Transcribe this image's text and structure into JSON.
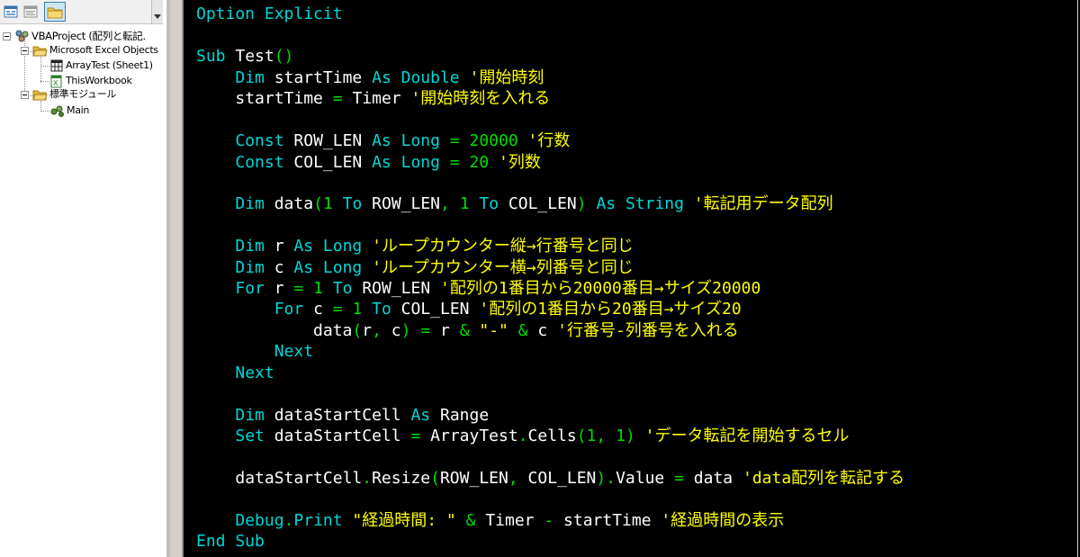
{
  "explorer": {
    "project_label": "VBAProject (配列と転記.",
    "folder_objects_label": "Microsoft Excel Objects",
    "sheet_label": "ArrayTest (Sheet1)",
    "workbook_label": "ThisWorkbook",
    "folder_modules_label": "標準モジュール",
    "module_label": "Main"
  },
  "colors": {
    "keyword": "#00d7d7",
    "identifier": "#ffffff",
    "number_operator": "#00dd00",
    "comment_string": "#ffff00",
    "background": "#000000"
  },
  "code": {
    "l1": {
      "a": "Option Explicit"
    },
    "l3": {
      "a": "Sub",
      "b": "Test",
      "c": "()"
    },
    "l4": {
      "a": "Dim",
      "b": "startTime",
      "c": "As Double",
      "d": "'開始時刻"
    },
    "l5": {
      "a": "startTime",
      "b": "=",
      "c": "Timer",
      "d": "'開始時刻を入れる"
    },
    "l7": {
      "a": "Const",
      "b": "ROW_LEN",
      "c": "As Long",
      "d": "=",
      "e": "20000",
      "f": "'行数"
    },
    "l8": {
      "a": "Const",
      "b": "COL_LEN",
      "c": "As Long",
      "d": "=",
      "e": "20",
      "f": "'列数"
    },
    "l10": {
      "a": "Dim",
      "b": "data",
      "c": "(",
      "d": "1",
      "e": "To",
      "f": "ROW_LEN",
      "g": ",",
      "h": "1",
      "i": "To",
      "j": "COL_LEN",
      "k": ")",
      "l": "As String",
      "m": "'転記用データ配列"
    },
    "l12": {
      "a": "Dim",
      "b": "r",
      "c": "As Long",
      "d": "'ループカウンター縦→行番号と同じ"
    },
    "l13": {
      "a": "Dim",
      "b": "c",
      "c": "As Long",
      "d": "'ループカウンター横→列番号と同じ"
    },
    "l14": {
      "a": "For",
      "b": "r",
      "c": "=",
      "d": "1",
      "e": "To",
      "f": "ROW_LEN",
      "g": "'配列の1番目から20000番目→サイズ20000"
    },
    "l15": {
      "a": "For",
      "b": "c",
      "c": "=",
      "d": "1",
      "e": "To",
      "f": "COL_LEN",
      "g": "'配列の1番目から20番目→サイズ20"
    },
    "l16": {
      "a": "data",
      "b": "(",
      "c": "r",
      "d": ",",
      "e": "c",
      "f": ")",
      "g": "=",
      "h": "r",
      "i": "&",
      "j": "\"-\"",
      "k": "&",
      "l": "c",
      "m": "'行番号-列番号を入れる"
    },
    "l17": {
      "a": "Next"
    },
    "l18": {
      "a": "Next"
    },
    "l20": {
      "a": "Dim",
      "b": "dataStartCell",
      "c": "As",
      "d": "Range"
    },
    "l21": {
      "a": "Set",
      "b": "dataStartCell",
      "c": "=",
      "d": "ArrayTest",
      "e": ".",
      "f": "Cells",
      "g": "(",
      "h": "1",
      "i": ",",
      "j": "1",
      "k": ")",
      "l": "'データ転記を開始するセル"
    },
    "l23": {
      "a": "dataStartCell",
      "b": ".",
      "c": "Resize",
      "d": "(",
      "e": "ROW_LEN",
      "f": ",",
      "g": "COL_LEN",
      "h": ")",
      "i": ".",
      "j": "Value",
      "k": "=",
      "l": "data",
      "m": "'data配列を転記する"
    },
    "l25": {
      "a": "Debug",
      "b": ".",
      "c": "Print",
      "d": "\"経過時間: \"",
      "e": "&",
      "f": "Timer",
      "g": "-",
      "h": "startTime",
      "i": "'経過時間の表示"
    },
    "l26": {
      "a": "End Sub"
    }
  }
}
